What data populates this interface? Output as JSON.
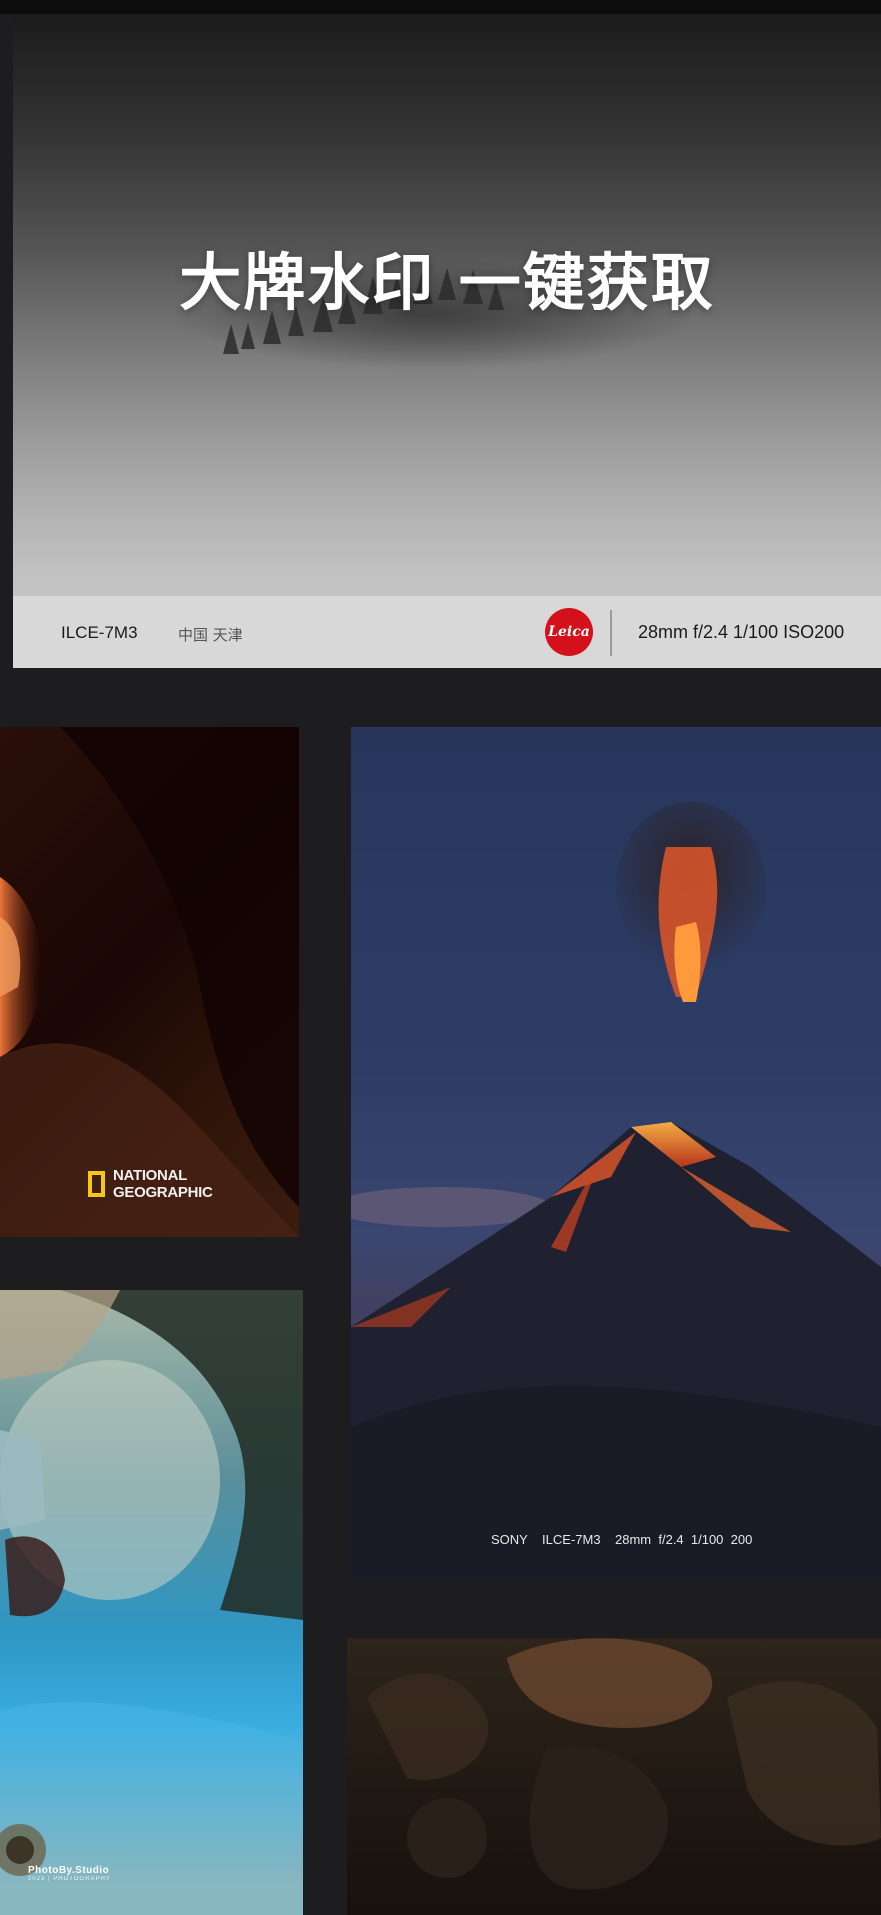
{
  "hero": {
    "title": "大牌水印 一键获取",
    "model": "ILCE-7M3",
    "location": "中国 天津",
    "brand_logo_text": "Leica",
    "params": "28mm f/2.4 1/100 ISO200",
    "logo_color": "#d4101b"
  },
  "cards": {
    "canyon": {
      "logo_line1": "NATIONAL",
      "logo_line2": "GEOGRAPHIC",
      "logo_color": "#f6c714"
    },
    "volcano": {
      "caption": "SONY    ILCE-7M3    28mm  f/2.4  1/100  200"
    },
    "portrait": {
      "watermark_main": "PhotoBy.Studio",
      "watermark_sub": "2023 | PHOTOGRAPHY"
    }
  },
  "colors": {
    "background": "#1d1d1f",
    "info_bar": "#d8d8d8"
  }
}
